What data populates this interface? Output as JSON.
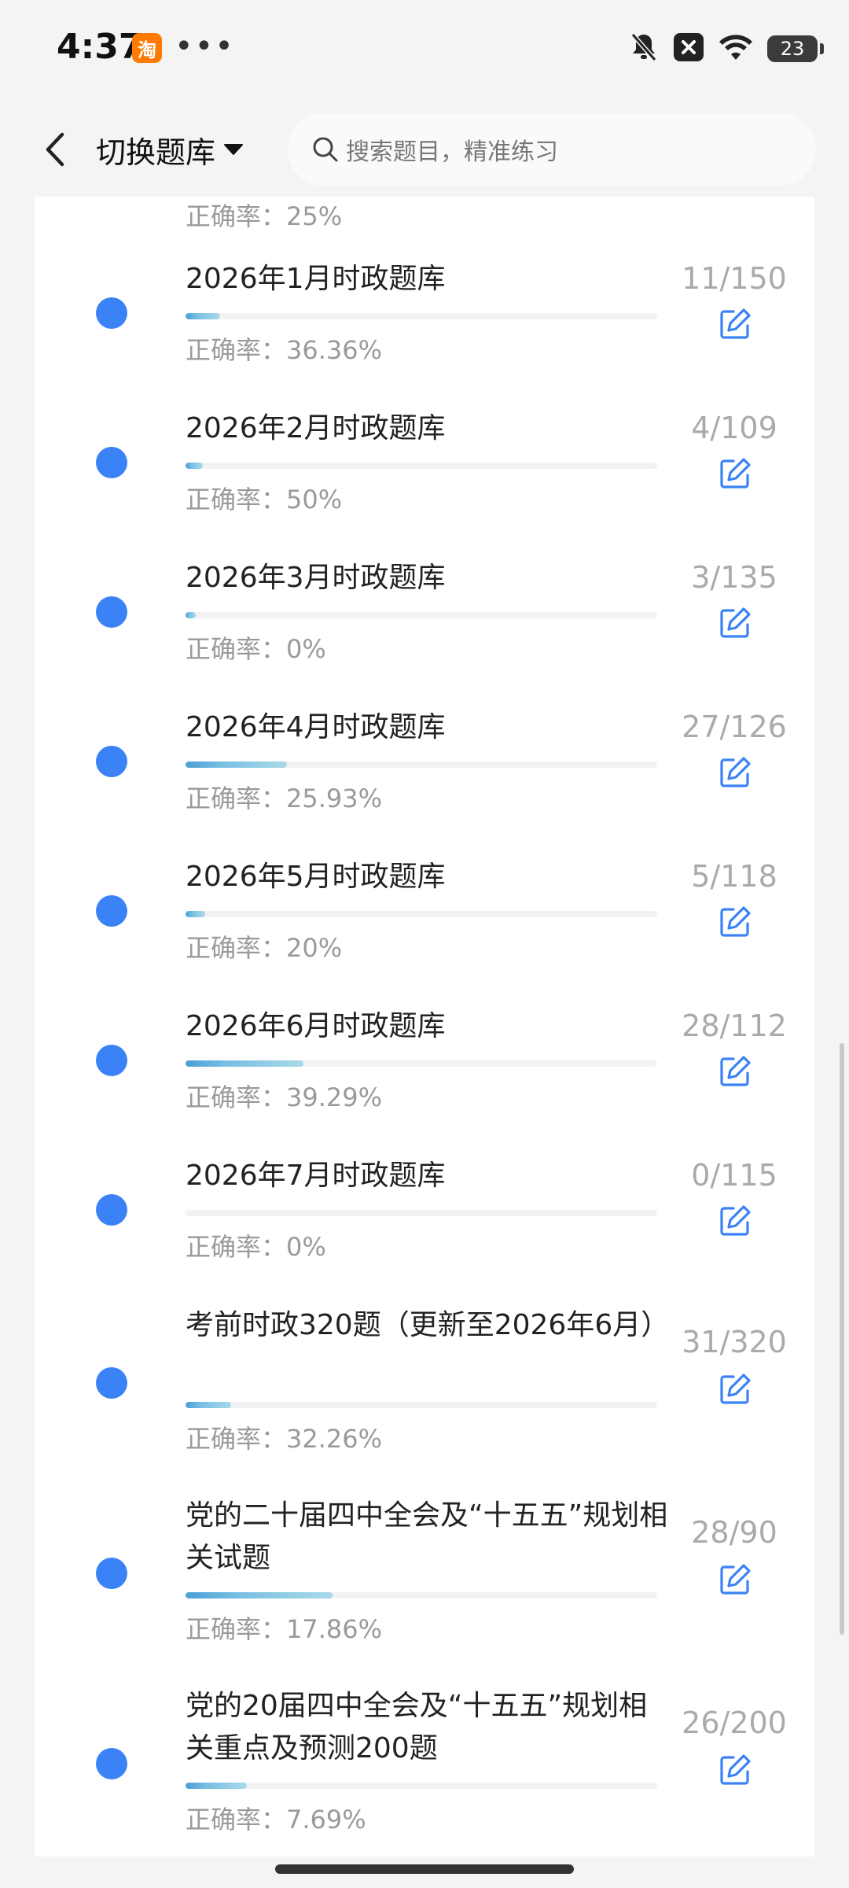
{
  "status_bar": {
    "time": "4:37",
    "app_badge": "淘",
    "more": "•••",
    "battery": "23",
    "icons": [
      "bell-muted-icon",
      "close-box-icon",
      "wifi-icon",
      "battery-icon"
    ]
  },
  "header": {
    "bank_switch_label": "切换题库",
    "search_placeholder": "搜索题目，精准练习"
  },
  "partial_item": {
    "accuracy": "正确率：25%"
  },
  "items": [
    {
      "title": "2026年1月时政题库",
      "accuracy": "正确率：36.36%",
      "count": "11/150",
      "progress": 0.0733
    },
    {
      "title": "2026年2月时政题库",
      "accuracy": "正确率：50%",
      "count": "4/109",
      "progress": 0.0367
    },
    {
      "title": "2026年3月时政题库",
      "accuracy": "正确率：0%",
      "count": "3/135",
      "progress": 0.0222
    },
    {
      "title": "2026年4月时政题库",
      "accuracy": "正确率：25.93%",
      "count": "27/126",
      "progress": 0.2143
    },
    {
      "title": "2026年5月时政题库",
      "accuracy": "正确率：20%",
      "count": "5/118",
      "progress": 0.0424
    },
    {
      "title": "2026年6月时政题库",
      "accuracy": "正确率：39.29%",
      "count": "28/112",
      "progress": 0.25
    },
    {
      "title": "2026年7月时政题库",
      "accuracy": "正确率：0%",
      "count": "0/115",
      "progress": 0
    },
    {
      "title": "考前时政320题（更新至2026年6月）",
      "accuracy": "正确率：32.26%",
      "count": "31/320",
      "progress": 0.0969
    },
    {
      "title": "党的二十届四中全会及“十五五”规划相关试题",
      "accuracy": "正确率：17.86%",
      "count": "28/90",
      "progress": 0.3111
    },
    {
      "title": "党的20届四中全会及“十五五”规划相关重点及预测200题",
      "accuracy": "正确率：7.69%",
      "count": "26/200",
      "progress": 0.13
    }
  ],
  "colors": {
    "dot": "#3b82f6",
    "edit_icon": "#3b82f6",
    "progress": "#78bfe3"
  }
}
